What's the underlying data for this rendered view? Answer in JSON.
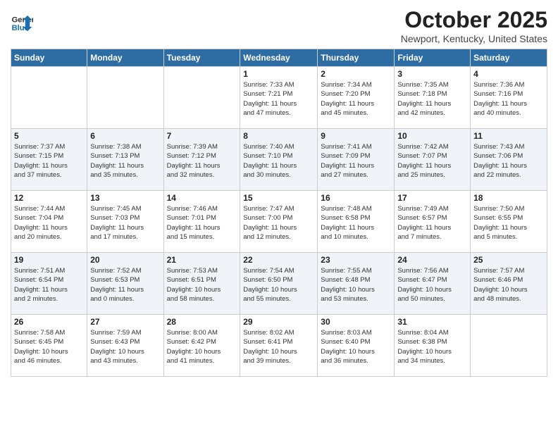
{
  "header": {
    "logo_general": "General",
    "logo_blue": "Blue",
    "month_title": "October 2025",
    "location": "Newport, Kentucky, United States"
  },
  "days_of_week": [
    "Sunday",
    "Monday",
    "Tuesday",
    "Wednesday",
    "Thursday",
    "Friday",
    "Saturday"
  ],
  "weeks": [
    [
      {
        "day": "",
        "info": ""
      },
      {
        "day": "",
        "info": ""
      },
      {
        "day": "",
        "info": ""
      },
      {
        "day": "1",
        "info": "Sunrise: 7:33 AM\nSunset: 7:21 PM\nDaylight: 11 hours\nand 47 minutes."
      },
      {
        "day": "2",
        "info": "Sunrise: 7:34 AM\nSunset: 7:20 PM\nDaylight: 11 hours\nand 45 minutes."
      },
      {
        "day": "3",
        "info": "Sunrise: 7:35 AM\nSunset: 7:18 PM\nDaylight: 11 hours\nand 42 minutes."
      },
      {
        "day": "4",
        "info": "Sunrise: 7:36 AM\nSunset: 7:16 PM\nDaylight: 11 hours\nand 40 minutes."
      }
    ],
    [
      {
        "day": "5",
        "info": "Sunrise: 7:37 AM\nSunset: 7:15 PM\nDaylight: 11 hours\nand 37 minutes."
      },
      {
        "day": "6",
        "info": "Sunrise: 7:38 AM\nSunset: 7:13 PM\nDaylight: 11 hours\nand 35 minutes."
      },
      {
        "day": "7",
        "info": "Sunrise: 7:39 AM\nSunset: 7:12 PM\nDaylight: 11 hours\nand 32 minutes."
      },
      {
        "day": "8",
        "info": "Sunrise: 7:40 AM\nSunset: 7:10 PM\nDaylight: 11 hours\nand 30 minutes."
      },
      {
        "day": "9",
        "info": "Sunrise: 7:41 AM\nSunset: 7:09 PM\nDaylight: 11 hours\nand 27 minutes."
      },
      {
        "day": "10",
        "info": "Sunrise: 7:42 AM\nSunset: 7:07 PM\nDaylight: 11 hours\nand 25 minutes."
      },
      {
        "day": "11",
        "info": "Sunrise: 7:43 AM\nSunset: 7:06 PM\nDaylight: 11 hours\nand 22 minutes."
      }
    ],
    [
      {
        "day": "12",
        "info": "Sunrise: 7:44 AM\nSunset: 7:04 PM\nDaylight: 11 hours\nand 20 minutes."
      },
      {
        "day": "13",
        "info": "Sunrise: 7:45 AM\nSunset: 7:03 PM\nDaylight: 11 hours\nand 17 minutes."
      },
      {
        "day": "14",
        "info": "Sunrise: 7:46 AM\nSunset: 7:01 PM\nDaylight: 11 hours\nand 15 minutes."
      },
      {
        "day": "15",
        "info": "Sunrise: 7:47 AM\nSunset: 7:00 PM\nDaylight: 11 hours\nand 12 minutes."
      },
      {
        "day": "16",
        "info": "Sunrise: 7:48 AM\nSunset: 6:58 PM\nDaylight: 11 hours\nand 10 minutes."
      },
      {
        "day": "17",
        "info": "Sunrise: 7:49 AM\nSunset: 6:57 PM\nDaylight: 11 hours\nand 7 minutes."
      },
      {
        "day": "18",
        "info": "Sunrise: 7:50 AM\nSunset: 6:55 PM\nDaylight: 11 hours\nand 5 minutes."
      }
    ],
    [
      {
        "day": "19",
        "info": "Sunrise: 7:51 AM\nSunset: 6:54 PM\nDaylight: 11 hours\nand 2 minutes."
      },
      {
        "day": "20",
        "info": "Sunrise: 7:52 AM\nSunset: 6:53 PM\nDaylight: 11 hours\nand 0 minutes."
      },
      {
        "day": "21",
        "info": "Sunrise: 7:53 AM\nSunset: 6:51 PM\nDaylight: 10 hours\nand 58 minutes."
      },
      {
        "day": "22",
        "info": "Sunrise: 7:54 AM\nSunset: 6:50 PM\nDaylight: 10 hours\nand 55 minutes."
      },
      {
        "day": "23",
        "info": "Sunrise: 7:55 AM\nSunset: 6:48 PM\nDaylight: 10 hours\nand 53 minutes."
      },
      {
        "day": "24",
        "info": "Sunrise: 7:56 AM\nSunset: 6:47 PM\nDaylight: 10 hours\nand 50 minutes."
      },
      {
        "day": "25",
        "info": "Sunrise: 7:57 AM\nSunset: 6:46 PM\nDaylight: 10 hours\nand 48 minutes."
      }
    ],
    [
      {
        "day": "26",
        "info": "Sunrise: 7:58 AM\nSunset: 6:45 PM\nDaylight: 10 hours\nand 46 minutes."
      },
      {
        "day": "27",
        "info": "Sunrise: 7:59 AM\nSunset: 6:43 PM\nDaylight: 10 hours\nand 43 minutes."
      },
      {
        "day": "28",
        "info": "Sunrise: 8:00 AM\nSunset: 6:42 PM\nDaylight: 10 hours\nand 41 minutes."
      },
      {
        "day": "29",
        "info": "Sunrise: 8:02 AM\nSunset: 6:41 PM\nDaylight: 10 hours\nand 39 minutes."
      },
      {
        "day": "30",
        "info": "Sunrise: 8:03 AM\nSunset: 6:40 PM\nDaylight: 10 hours\nand 36 minutes."
      },
      {
        "day": "31",
        "info": "Sunrise: 8:04 AM\nSunset: 6:38 PM\nDaylight: 10 hours\nand 34 minutes."
      },
      {
        "day": "",
        "info": ""
      }
    ]
  ]
}
